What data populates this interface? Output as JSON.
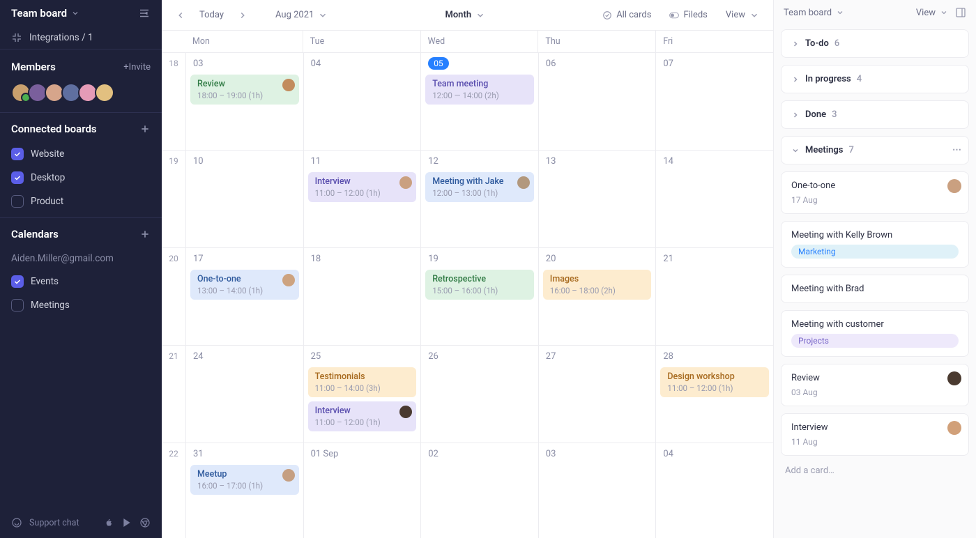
{
  "sidebar": {
    "board_title": "Team board",
    "integrations_label": "Integrations / 1",
    "members_label": "Members",
    "invite_label": "+Invite",
    "connected_boards_label": "Connected boards",
    "boards": [
      {
        "label": "Website",
        "checked": true
      },
      {
        "label": "Desktop",
        "checked": true
      },
      {
        "label": "Product",
        "checked": false
      }
    ],
    "calendars_label": "Calendars",
    "calendar_email": "Aiden.Miller@gmail.com",
    "calendars": [
      {
        "label": "Events",
        "checked": true
      },
      {
        "label": "Meetings",
        "checked": false
      }
    ],
    "support_label": "Support chat"
  },
  "avatarColors": [
    "#c9a06e",
    "#7a5f9c",
    "#d6a58b",
    "#5f6fa0",
    "#e59bb7",
    "#e2c080"
  ],
  "toolbar": {
    "today": "Today",
    "month_label": "Aug 2021",
    "view_unit": "Month",
    "all_cards": "All cards",
    "fields": "Fileds",
    "view": "View"
  },
  "weekHeaders": [
    "Mon",
    "Tue",
    "Wed",
    "Thu",
    "Fri"
  ],
  "weeks": [
    {
      "num": "18",
      "days": [
        {
          "date": "03",
          "events": [
            {
              "title": "Review",
              "time": "18:00 – 19:00 (1h)",
              "color": "green",
              "avatar": "#c28c5e"
            }
          ]
        },
        {
          "date": "04",
          "events": []
        },
        {
          "date": "05",
          "today": true,
          "events": [
            {
              "title": "Team meeting",
              "time": "12:00 — 14:00 (2h)",
              "color": "purple"
            }
          ]
        },
        {
          "date": "06",
          "events": []
        },
        {
          "date": "07",
          "events": []
        }
      ]
    },
    {
      "num": "19",
      "days": [
        {
          "date": "10",
          "events": []
        },
        {
          "date": "11",
          "events": [
            {
              "title": "Interview",
              "time": "11:00 – 12:00 (1h)",
              "color": "purple",
              "avatar": "#caa080"
            }
          ]
        },
        {
          "date": "12",
          "events": [
            {
              "title": "Meeting with Jake",
              "time": "12:00 – 13:00 (1h)",
              "color": "blue",
              "avatar": "#b2987d"
            }
          ]
        },
        {
          "date": "13",
          "events": []
        },
        {
          "date": "14",
          "events": []
        }
      ]
    },
    {
      "num": "20",
      "days": [
        {
          "date": "17",
          "events": [
            {
              "title": "One-to-one",
              "time": "13:00 – 14:00 (1h)",
              "color": "blue",
              "avatar": "#cda380"
            }
          ]
        },
        {
          "date": "18",
          "events": []
        },
        {
          "date": "19",
          "events": [
            {
              "title": "Retrospective",
              "time": "15:00 – 16:00 (1h)",
              "color": "green"
            }
          ]
        },
        {
          "date": "20",
          "events": [
            {
              "title": "Images",
              "time": "16:00 – 18:00 (2h)",
              "color": "orange"
            }
          ]
        },
        {
          "date": "21",
          "events": []
        }
      ]
    },
    {
      "num": "21",
      "days": [
        {
          "date": "24",
          "events": []
        },
        {
          "date": "25",
          "events": [
            {
              "title": "Testimonials",
              "time": "11:00 – 14:00 (3h)",
              "color": "orange"
            },
            {
              "title": "Interview",
              "time": "11:00 – 12:00 (1h)",
              "color": "purple",
              "avatar": "#4a3a30"
            }
          ]
        },
        {
          "date": "26",
          "events": []
        },
        {
          "date": "27",
          "events": []
        },
        {
          "date": "28",
          "events": [
            {
              "title": "Design workshop",
              "time": "11:00 – 12:00 (1h)",
              "color": "orange"
            }
          ]
        }
      ]
    },
    {
      "num": "22",
      "days": [
        {
          "date": "31",
          "events": [
            {
              "title": "Meetup",
              "time": "16:00 – 17:00 (1h)",
              "color": "blue",
              "avatar": "#c59f82"
            }
          ]
        },
        {
          "date": "01 Sep",
          "events": []
        },
        {
          "date": "02",
          "events": []
        },
        {
          "date": "03",
          "events": []
        },
        {
          "date": "04",
          "events": []
        }
      ]
    }
  ],
  "panel": {
    "title": "Team board",
    "view": "View",
    "groups": [
      {
        "label": "To-do",
        "count": "6",
        "open": false
      },
      {
        "label": "In progress",
        "count": "4",
        "open": false
      },
      {
        "label": "Done",
        "count": "3",
        "open": false
      },
      {
        "label": "Meetings",
        "count": "7",
        "open": true
      }
    ],
    "cards": [
      {
        "title": "One-to-one",
        "date": "17 Aug",
        "avatar": "#caa080"
      },
      {
        "title": "Meeting with Kelly Brown",
        "tag": {
          "label": "Marketing",
          "cls": "tag-blue"
        }
      },
      {
        "title": "Meeting with Brad"
      },
      {
        "title": "Meeting with customer",
        "tag": {
          "label": "Projects",
          "cls": "tag-purple"
        }
      },
      {
        "title": "Review",
        "date": "03 Aug",
        "avatar": "#4a3a30"
      },
      {
        "title": "Interview",
        "date": "11 Aug",
        "avatar": "#d1a079"
      }
    ],
    "add_card": "Add a card…"
  }
}
